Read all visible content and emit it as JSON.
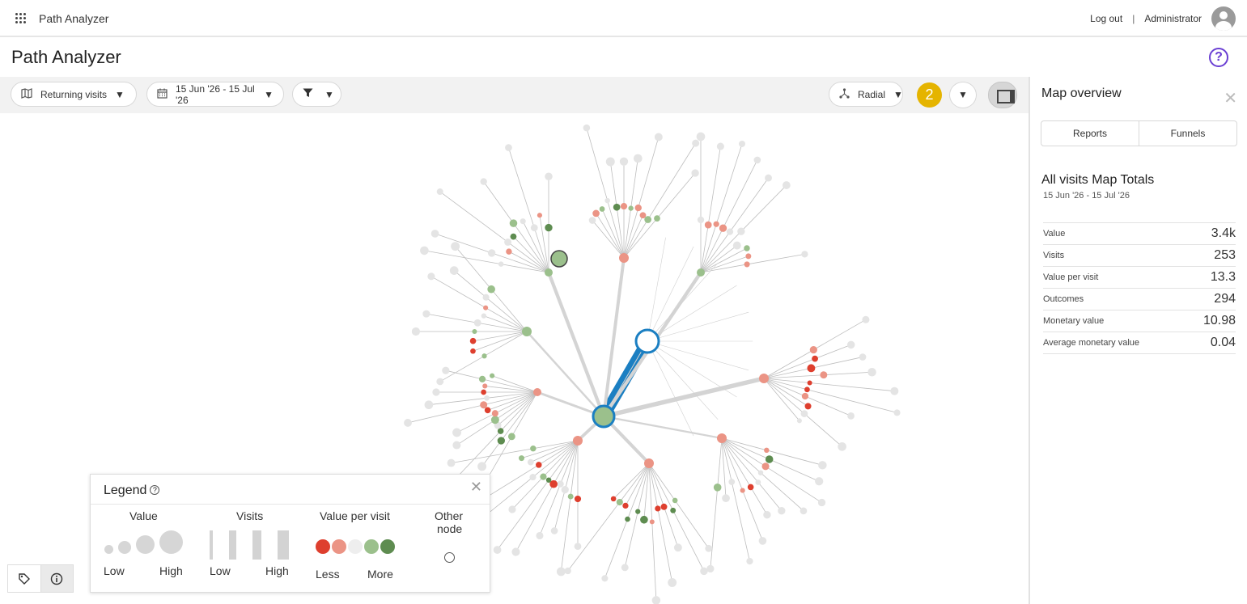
{
  "topbar": {
    "app_name": "Path Analyzer",
    "logout": "Log out",
    "separator": "|",
    "user": "Administrator"
  },
  "page": {
    "title": "Path Analyzer",
    "help_symbol": "?"
  },
  "toolbar": {
    "segment": "Returning visits",
    "date_range": "15 Jun '26 - 15 Jul '26",
    "layout": "Radial",
    "filter_count": "2",
    "caret": "▼"
  },
  "side_panel": {
    "title": "Map overview",
    "close": "✕",
    "tabs": [
      "Reports",
      "Funnels"
    ],
    "totals_title": "All visits Map Totals",
    "totals_date": "15 Jun '26 - 15 Jul '26",
    "metrics": [
      {
        "label": "Value",
        "value": "3.4k"
      },
      {
        "label": "Visits",
        "value": "253"
      },
      {
        "label": "Value per visit",
        "value": "13.3"
      },
      {
        "label": "Outcomes",
        "value": "294"
      },
      {
        "label": "Monetary value",
        "value": "10.98"
      },
      {
        "label": "Average monetary value",
        "value": "0.04"
      }
    ]
  },
  "legend": {
    "title": "Legend",
    "help_symbol": "?",
    "close": "✕",
    "value": {
      "heading": "Value",
      "low": "Low",
      "high": "High"
    },
    "visits": {
      "heading": "Visits",
      "low": "Low",
      "high": "High"
    },
    "vpv": {
      "heading": "Value per visit",
      "less": "Less",
      "more": "More",
      "colors": [
        "#de3f2e",
        "#eb9485",
        "#eeeeee",
        "#9bc08c",
        "#5e8c50"
      ]
    },
    "other": {
      "heading_1": "Other",
      "heading_2": "node"
    }
  },
  "colors": {
    "accent": "#6a3fd3",
    "link_strong": "#1b7fc2",
    "badge": "#e5b400",
    "node_red": "#de3f2e",
    "node_salmon": "#eb9485",
    "node_light_green": "#9bc08c",
    "node_dark_green": "#5e8c50",
    "node_grey": "#e4e4e4"
  },
  "icons": {
    "apps": "apps-grid-icon",
    "avatar": "user-avatar-icon",
    "segment": "map-icon",
    "date": "calendar-icon",
    "filter": "filter-icon",
    "layout": "radial-layout-icon",
    "tags": "tag-icon",
    "info": "info-icon"
  }
}
